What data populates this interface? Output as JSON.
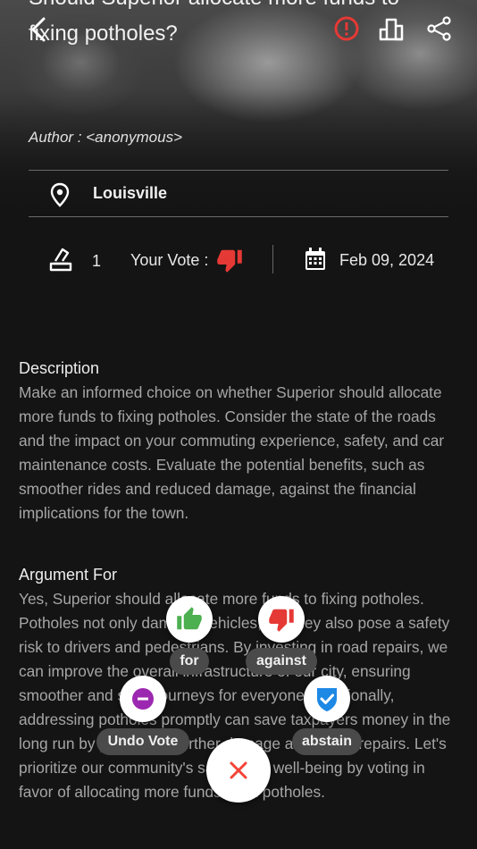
{
  "header": {
    "title": "Should Superior allocate more funds to fixing potholes?",
    "author": "Author : <anonymous>",
    "location": "Louisville"
  },
  "stats": {
    "vote_count": "1",
    "your_vote_label": "Your Vote :",
    "date": "Feb 09, 2024"
  },
  "description": {
    "label": "Description",
    "text": "Make an informed choice on whether Superior should allocate more funds to fixing potholes. Consider the state of the roads and the impact on your commuting experience, safety, and car maintenance costs. Evaluate the potential benefits, such as smoother rides and reduced damage, against the financial implications for the town."
  },
  "argument_for": {
    "label": "Argument For",
    "text": "Yes, Superior should allocate more funds to fixing potholes. Potholes not only damage vehicles, but they also pose a safety risk to drivers and pedestrians. By investing in road repairs, we can improve the overall infrastructure of our city, ensuring smoother and safer journeys for everyone. Additionally, addressing potholes promptly can save taxpayers money in the long run by preventing further damage and costly repairs. Let's prioritize our community's safety and well-being by voting in favor of allocating more funds to fix potholes."
  },
  "vote_actions": {
    "for_label": "for",
    "against_label": "against",
    "undo_label": "Undo Vote",
    "abstain_label": "abstain"
  },
  "colors": {
    "for": "#4caf50",
    "against": "#e53935",
    "undo": "#9c27b0",
    "abstain": "#1e88e5",
    "close": "#f44336",
    "report": "#e53935"
  }
}
